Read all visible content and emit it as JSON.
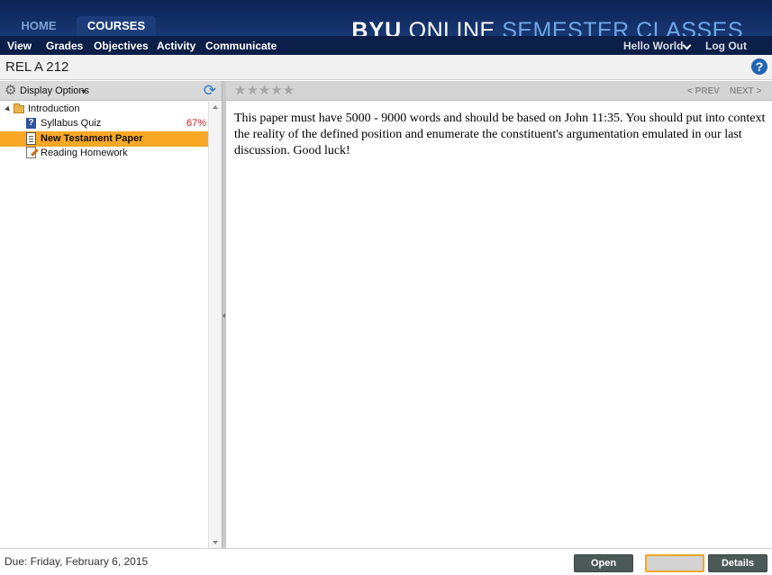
{
  "header": {
    "tabs": [
      {
        "label": "HOME"
      },
      {
        "label": "COURSES"
      }
    ],
    "brand": {
      "bold": "BYU",
      "light": "ONLINE",
      "accent": "SEMESTER CLASSES"
    }
  },
  "nav": {
    "items": [
      {
        "label": "View"
      },
      {
        "label": "Grades"
      },
      {
        "label": "Objectives"
      },
      {
        "label": "Activity"
      },
      {
        "label": "Communicate"
      }
    ],
    "user": "Hello World",
    "logout": "Log Out"
  },
  "course": {
    "title": "REL A 212",
    "help_icon": "question-circle-icon"
  },
  "left_panel": {
    "display_options": "Display Options",
    "tree": [
      {
        "label": "Introduction",
        "icon": "folder-icon"
      },
      {
        "label": "Syllabus Quiz",
        "icon": "quiz-icon",
        "score": "67%"
      },
      {
        "label": "New Testament Paper",
        "icon": "document-icon",
        "selected": true
      },
      {
        "label": "Reading Homework",
        "icon": "reading-icon"
      }
    ]
  },
  "right_panel": {
    "stars": "★★★★★",
    "prev": "< PREV",
    "next": "NEXT >",
    "content": "This paper must have 5000 - 9000 words and should be based on John 11:35. You should put into context the reality of the defined position and enumerate the constituent's argumentation emulated in our last discussion. Good luck!"
  },
  "footer": {
    "due": "Due: Friday, February 6, 2015",
    "open": "Open",
    "details": "Details"
  },
  "colors": {
    "header_dark": "#0c1f48",
    "selected": "#f9a825",
    "accent_blue": "#6fa7e3"
  }
}
